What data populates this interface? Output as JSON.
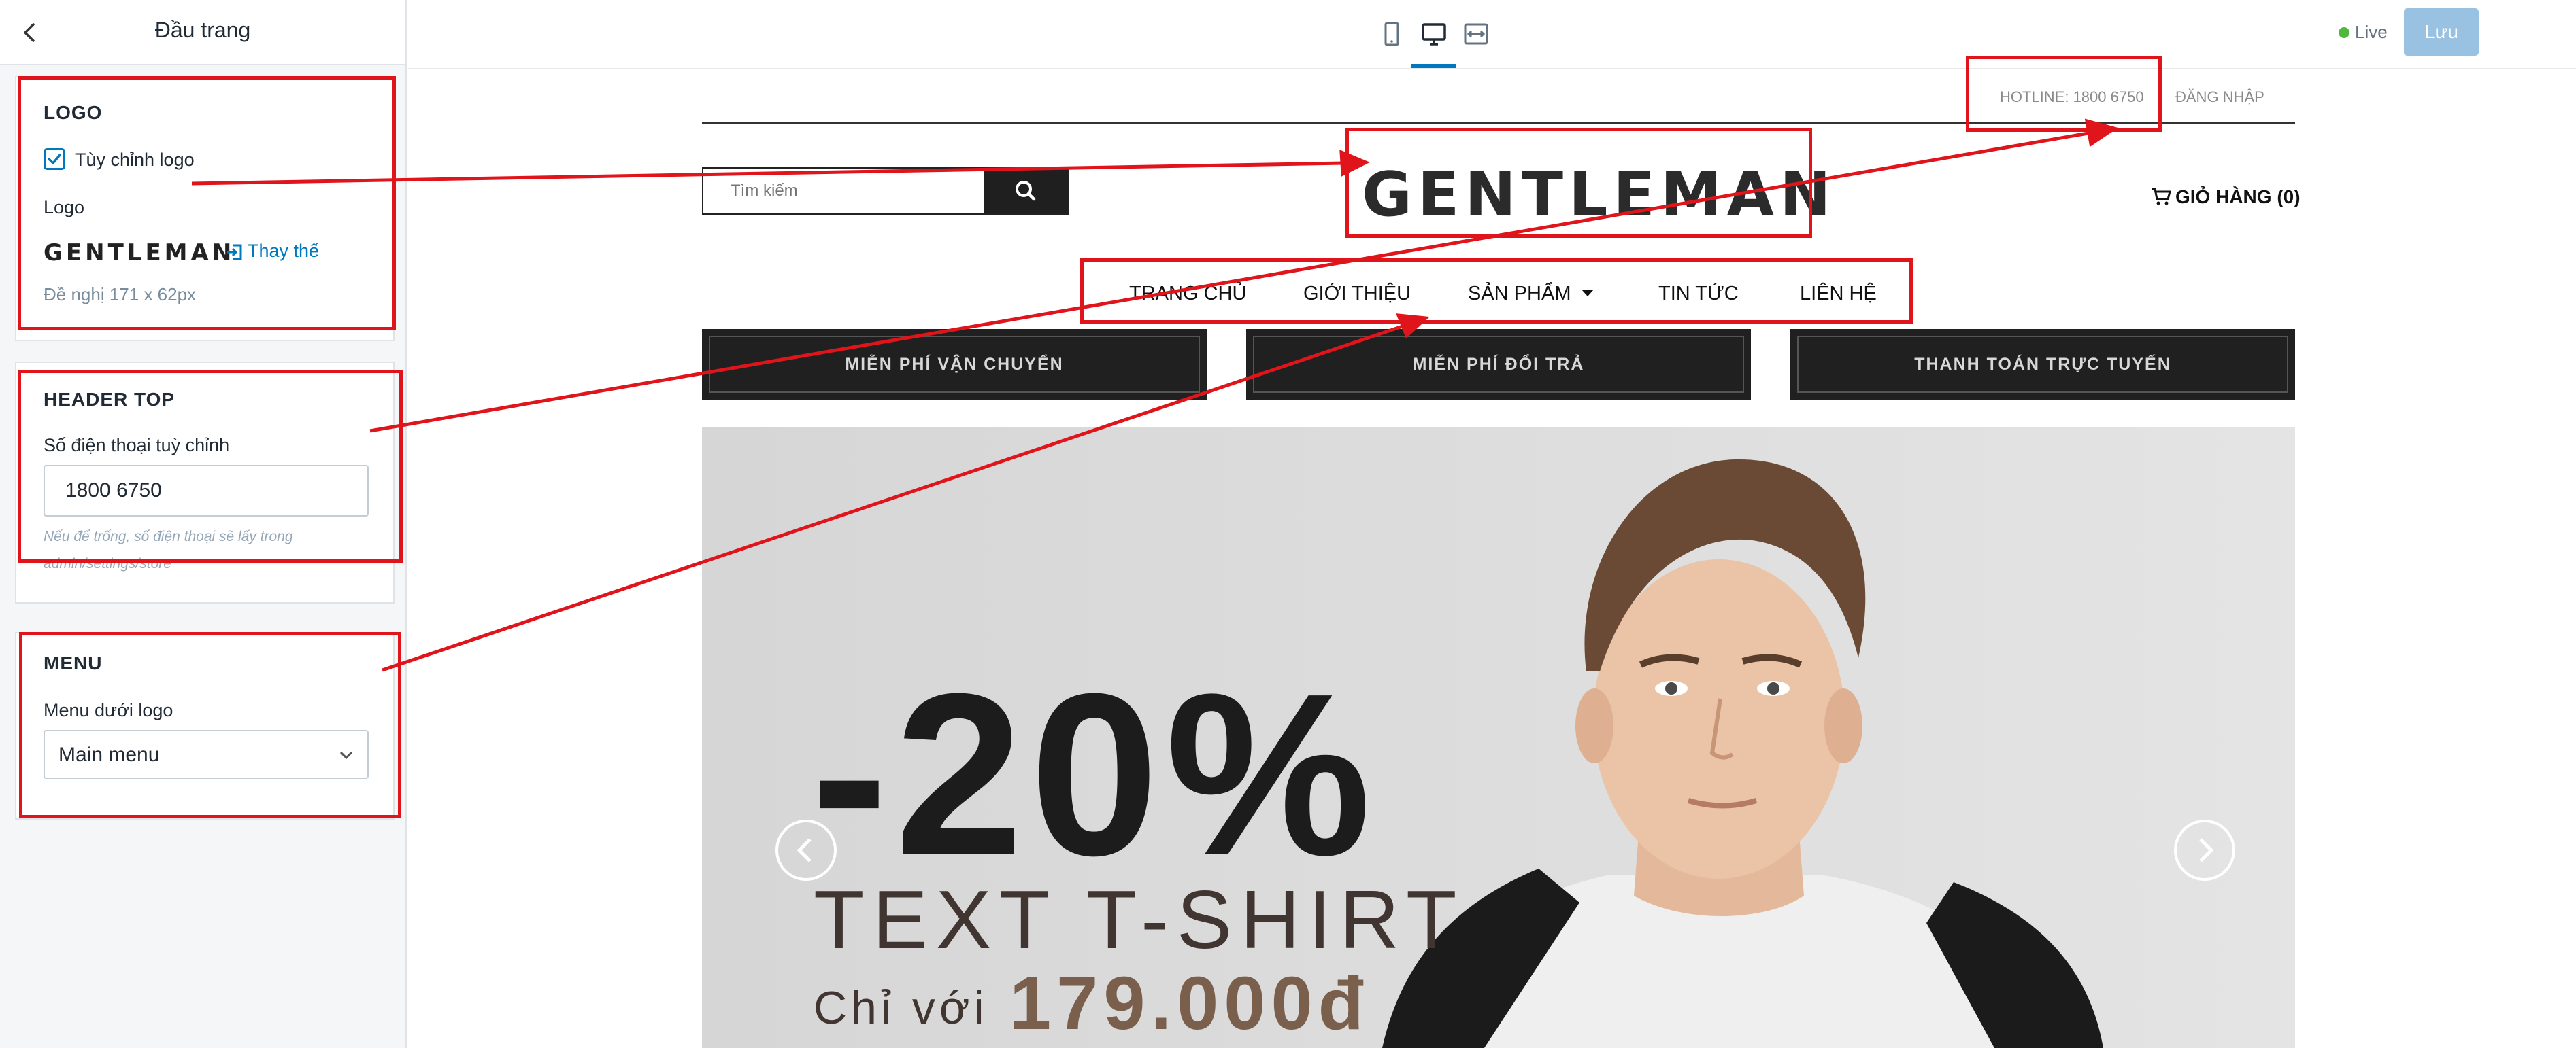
{
  "panel": {
    "title": "Đầu trang",
    "logo_section": {
      "heading": "LOGO",
      "custom_logo_label": "Tùy chỉnh logo",
      "custom_logo_checked": true,
      "logo_label": "Logo",
      "logo_preview": "GENTLEMAN",
      "replace_label": "Thay thế",
      "size_hint": "Đề nghị 171 x 62px"
    },
    "header_top_section": {
      "heading": "HEADER TOP",
      "phone_label": "Số điện thoại tuỳ chỉnh",
      "phone_value": "1800 6750",
      "phone_note": "Nếu để trống, số điện thoại sẽ lấy trong admin/settings/store"
    },
    "menu_section": {
      "heading": "MENU",
      "menu_label": "Menu dưới logo",
      "menu_selected": "Main menu"
    }
  },
  "toolbar": {
    "devices": [
      "mobile-icon",
      "desktop-icon",
      "fullwidth-icon"
    ],
    "active_device": "desktop-icon",
    "live_label": "Live",
    "save_label": "Lưu"
  },
  "site": {
    "hotline": "HOTLINE: 1800 6750",
    "login": "ĐĂNG NHẬP",
    "search_placeholder": "Tìm kiếm",
    "logo": "GENTLEMAN",
    "cart": "GIỎ HÀNG (0)",
    "menu": [
      "TRANG CHỦ",
      "GIỚI THIỆU",
      "SẢN PHẨM",
      "TIN TỨC",
      "LIÊN HỆ"
    ],
    "promos": [
      "MIỄN PHÍ VẬN CHUYỂN",
      "MIỄN PHÍ ĐỔI TRẢ",
      "THANH TOÁN TRỰC TUYẾN"
    ],
    "banner": {
      "discount": "-20%",
      "product": "TEXT T-SHIRT",
      "price_label": "Chỉ với",
      "price": "179.000đ"
    }
  },
  "colors": {
    "accent": "#0078bd",
    "annotation": "#e0141b",
    "save_button": "#99c1e2",
    "live_dot": "#50b83c",
    "promo_bg": "#202020",
    "price": "#7a5f4d"
  }
}
